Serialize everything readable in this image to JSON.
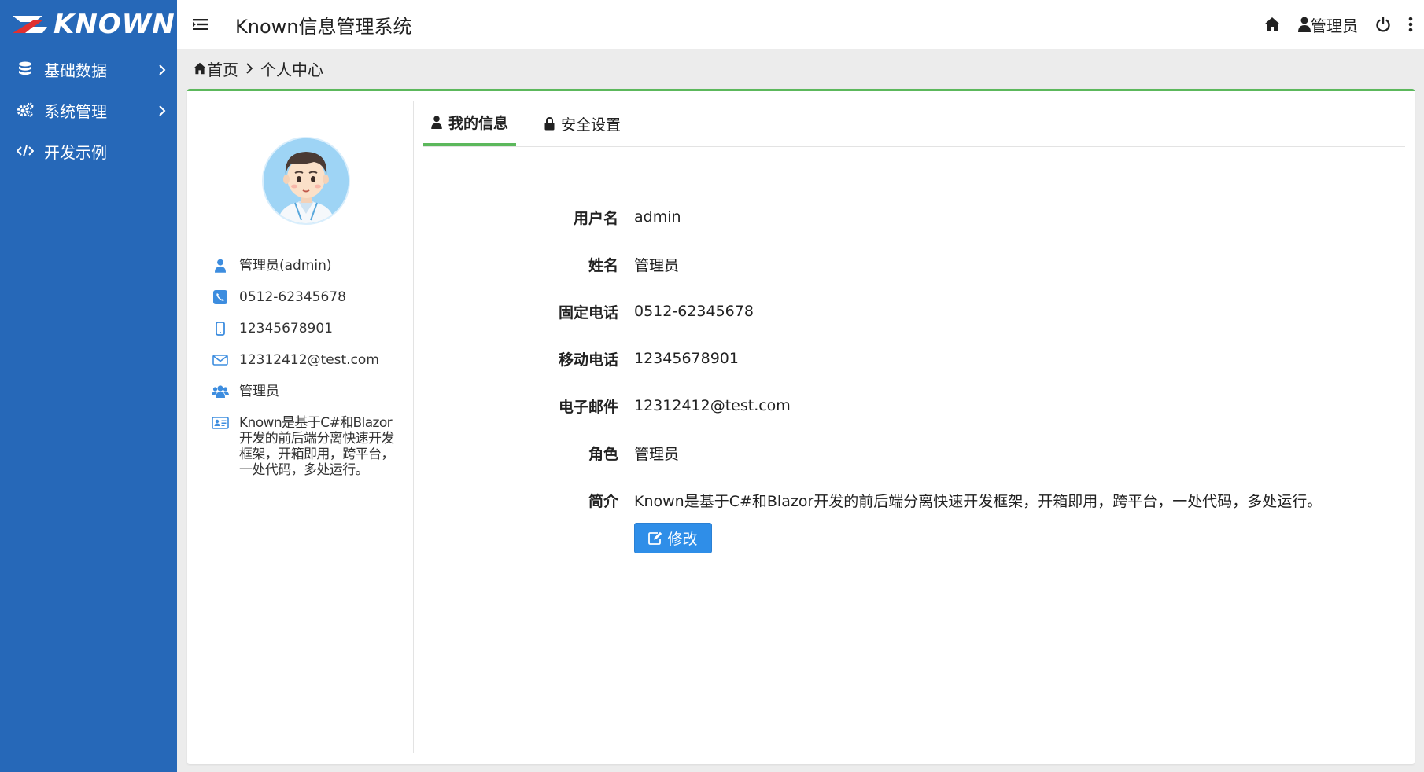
{
  "brand": {
    "logo_text": "KNOWN"
  },
  "sidebar": {
    "items": [
      {
        "label": "基础数据",
        "icon": "database-icon",
        "has_children": true
      },
      {
        "label": "系统管理",
        "icon": "cogs-icon",
        "has_children": true
      },
      {
        "label": "开发示例",
        "icon": "code-icon",
        "has_children": false
      }
    ]
  },
  "header": {
    "title": "Known信息管理系统",
    "user_label": "管理员",
    "icons": [
      "menu-icon",
      "home-icon",
      "user-icon",
      "power-icon",
      "more-vertical-icon"
    ]
  },
  "breadcrumb": {
    "home": "首页",
    "current": "个人中心"
  },
  "profile": {
    "display_name": "管理员(admin)",
    "phone": "0512-62345678",
    "mobile": "12345678901",
    "email": "12312412@test.com",
    "role": "管理员",
    "intro": "Known是基于C#和Blazor开发的前后端分离快速开发框架，开箱即用，跨平台，一处代码，多处运行。"
  },
  "tabs": [
    {
      "label": "我的信息",
      "icon": "user-icon",
      "active": true
    },
    {
      "label": "安全设置",
      "icon": "lock-icon",
      "active": false
    }
  ],
  "form": {
    "fields": [
      {
        "label": "用户名",
        "value": "admin"
      },
      {
        "label": "姓名",
        "value": "管理员"
      },
      {
        "label": "固定电话",
        "value": "0512-62345678"
      },
      {
        "label": "移动电话",
        "value": "12345678901"
      },
      {
        "label": "电子邮件",
        "value": "12312412@test.com"
      },
      {
        "label": "角色",
        "value": "管理员"
      },
      {
        "label": "简介",
        "value": "Known是基于C#和Blazor开发的前后端分离快速开发框架，开箱即用，跨平台，一处代码，多处运行。"
      }
    ],
    "edit_label": "修改"
  },
  "colors": {
    "sidebar_bg": "#2668b8",
    "accent_green": "#5cb85c",
    "primary_button": "#2f8ee8",
    "icon_blue": "#3d8ddf"
  }
}
